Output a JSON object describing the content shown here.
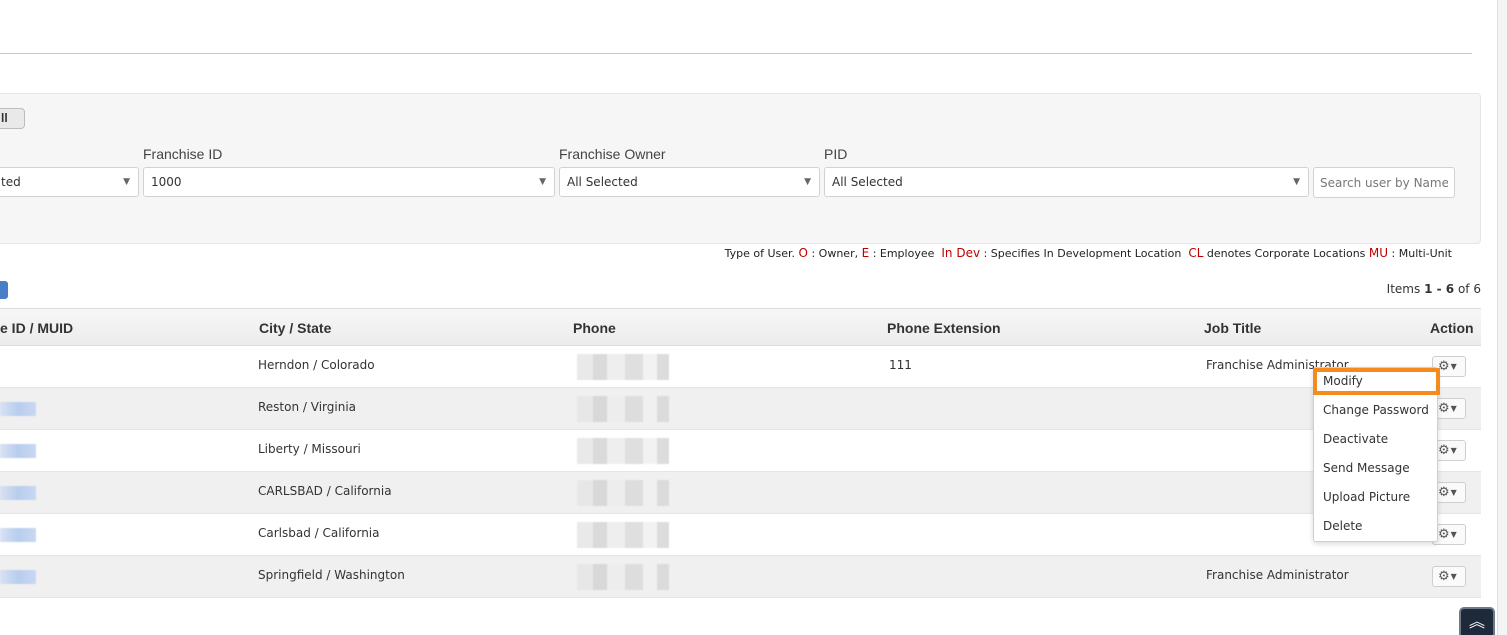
{
  "filter": {
    "partial_button_label": "ll",
    "first_select_value": "ted",
    "franchise_id_label": "Franchise ID",
    "franchise_id_value": "1000",
    "franchise_owner_label": "Franchise Owner",
    "franchise_owner_value": "All Selected",
    "pid_label": "PID",
    "pid_value": "All Selected",
    "search_placeholder": "Search user by Name"
  },
  "legend": {
    "prefix": "Type of User.",
    "o_code": "O",
    "o_text": ": Owner,",
    "e_code": "E",
    "e_text": ": Employee",
    "indev_code": "In Dev",
    "indev_text": ": Specifies In Development Location",
    "cl_code": "CL",
    "cl_text": "denotes Corporate Locations",
    "mu_code": "MU",
    "mu_text": ": Multi-Unit"
  },
  "items": {
    "prefix": "Items",
    "range": "1 - 6",
    "of": "of",
    "total": "6"
  },
  "table": {
    "headers": {
      "id": "e ID / MUID",
      "city": "City / State",
      "phone": "Phone",
      "ext": "Phone Extension",
      "job": "Job Title",
      "action": "Action"
    },
    "rows": [
      {
        "city": "Herndon / Colorado",
        "ext": "111",
        "job": "Franchise Administrator"
      },
      {
        "city": "Reston / Virginia",
        "ext": "",
        "job": ""
      },
      {
        "city": "Liberty / Missouri",
        "ext": "",
        "job": ""
      },
      {
        "city": "CARLSBAD / California",
        "ext": "",
        "job": ""
      },
      {
        "city": "Carlsbad / California",
        "ext": "",
        "job": ""
      },
      {
        "city": "Springfield / Washington",
        "ext": "",
        "job": "Franchise Administrator"
      }
    ]
  },
  "action_menu": {
    "items": [
      "Modify",
      "Change Password",
      "Deactivate",
      "Send Message",
      "Upload Picture",
      "Delete"
    ]
  },
  "colors": {
    "highlight": "#f58b1f",
    "legend_code": "#c00000",
    "accent_blue": "#4a7fc8"
  }
}
